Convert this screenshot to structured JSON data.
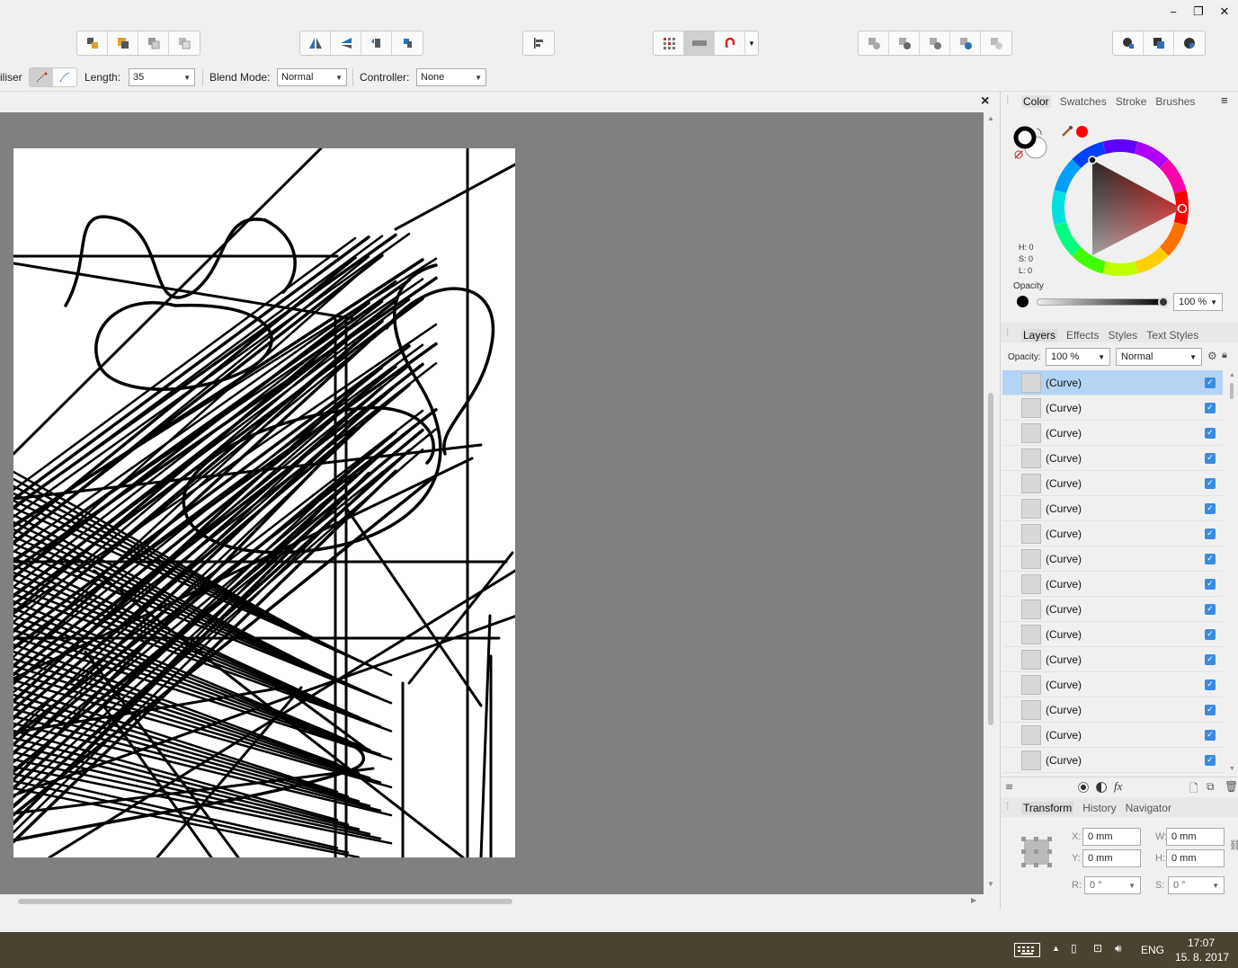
{
  "window": {
    "minimize": "−",
    "restore": "❐",
    "close": "✕"
  },
  "context_bar": {
    "tool_fragment": "iliser",
    "length_label": "Length:",
    "length_value": "35",
    "blend_label": "Blend Mode:",
    "blend_value": "Normal",
    "controller_label": "Controller:",
    "controller_value": "None"
  },
  "canvas": {
    "close_doc": "×"
  },
  "color_panel": {
    "tabs": [
      "Color",
      "Swatches",
      "Stroke",
      "Brushes"
    ],
    "h": "H: 0",
    "s": "S: 0",
    "l": "L: 0",
    "opacity_label": "Opacity",
    "opacity_value": "100 %",
    "accent_red": "#ff0000"
  },
  "layers_panel": {
    "tabs": [
      "Layers",
      "Effects",
      "Styles",
      "Text Styles"
    ],
    "opacity_label": "Opacity:",
    "opacity_value": "100 %",
    "blend_value": "Normal",
    "layers": [
      "(Curve)",
      "(Curve)",
      "(Curve)",
      "(Curve)",
      "(Curve)",
      "(Curve)",
      "(Curve)",
      "(Curve)",
      "(Curve)",
      "(Curve)",
      "(Curve)",
      "(Curve)",
      "(Curve)",
      "(Curve)",
      "(Curve)",
      "(Curve)"
    ],
    "fx_label": "fx"
  },
  "transform_panel": {
    "tabs": [
      "Transform",
      "History",
      "Navigator"
    ],
    "x_label": "X:",
    "x_value": "0 mm",
    "y_label": "Y:",
    "y_value": "0 mm",
    "w_label": "W:",
    "w_value": "0 mm",
    "h_label": "H:",
    "h_value": "0 mm",
    "r_label": "R:",
    "r_value": "0 °",
    "s_label": "S:",
    "s_value": "0 °"
  },
  "taskbar": {
    "lang": "ENG",
    "time": "17:07",
    "date": "15. 8. 2017"
  },
  "colors": {
    "selection": "#b4d4f5",
    "checkbox": "#3b8be0",
    "canvas_bg": "#808080",
    "taskbar": "#4a4332"
  }
}
